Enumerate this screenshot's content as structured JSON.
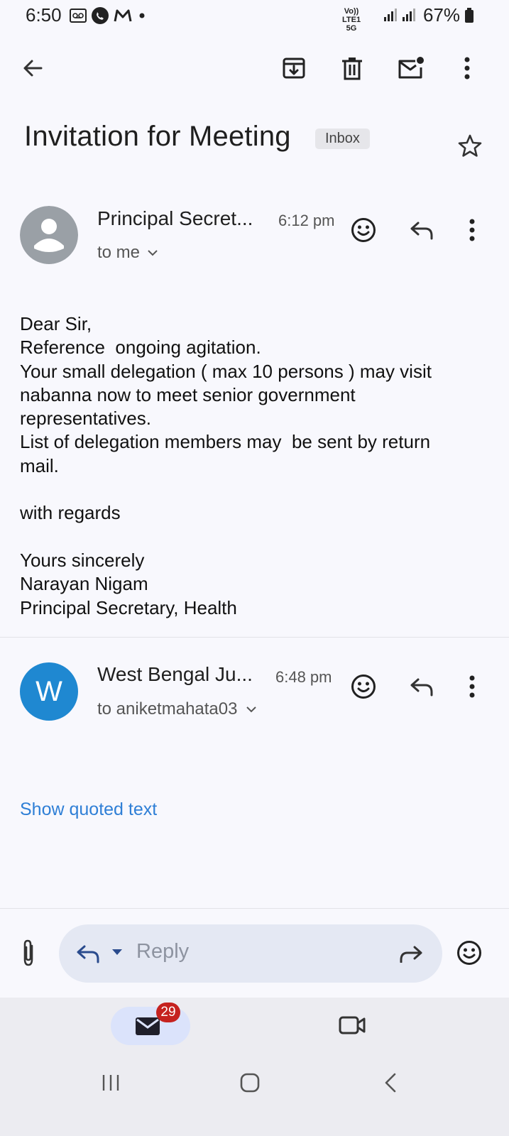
{
  "status_bar": {
    "time": "6:50",
    "network": "Vo)) LTE1 5G",
    "battery": "67%"
  },
  "toolbar": {
    "icons": [
      "back-arrow-icon",
      "archive-icon",
      "delete-icon",
      "mark-unread-icon",
      "more-vert-icon"
    ]
  },
  "email": {
    "subject": "Invitation for Meeting",
    "label": "Inbox"
  },
  "messages": [
    {
      "sender": "Principal Secret...",
      "time": "6:12 pm",
      "to": "to me",
      "avatar_color": "#9aa0a6",
      "body": "Dear Sir,\nReference  ongoing agitation.\nYour small delegation ( max 10 persons ) may visit\nnabanna now to meet senior government\nrepresentatives.\nList of delegation members may  be sent by return\nmail.\n\nwith regards\n\nYours sincerely\nNarayan Nigam\nPrincipal Secretary, Health"
    },
    {
      "sender": "West Bengal Ju...",
      "time": "6:48 pm",
      "to": "to aniketmahata03",
      "avatar_letter": "W",
      "avatar_color": "#1f88d1",
      "show_quoted": "Show quoted text"
    }
  ],
  "reply_bar": {
    "placeholder": "Reply"
  },
  "bottom_nav": {
    "mail_badge": "29"
  },
  "colors": {
    "accent_link": "#2f7fd6",
    "badge_red": "#c5221f",
    "reply_pill": "#e4e8f3",
    "nav_active": "#dbe3fb"
  }
}
